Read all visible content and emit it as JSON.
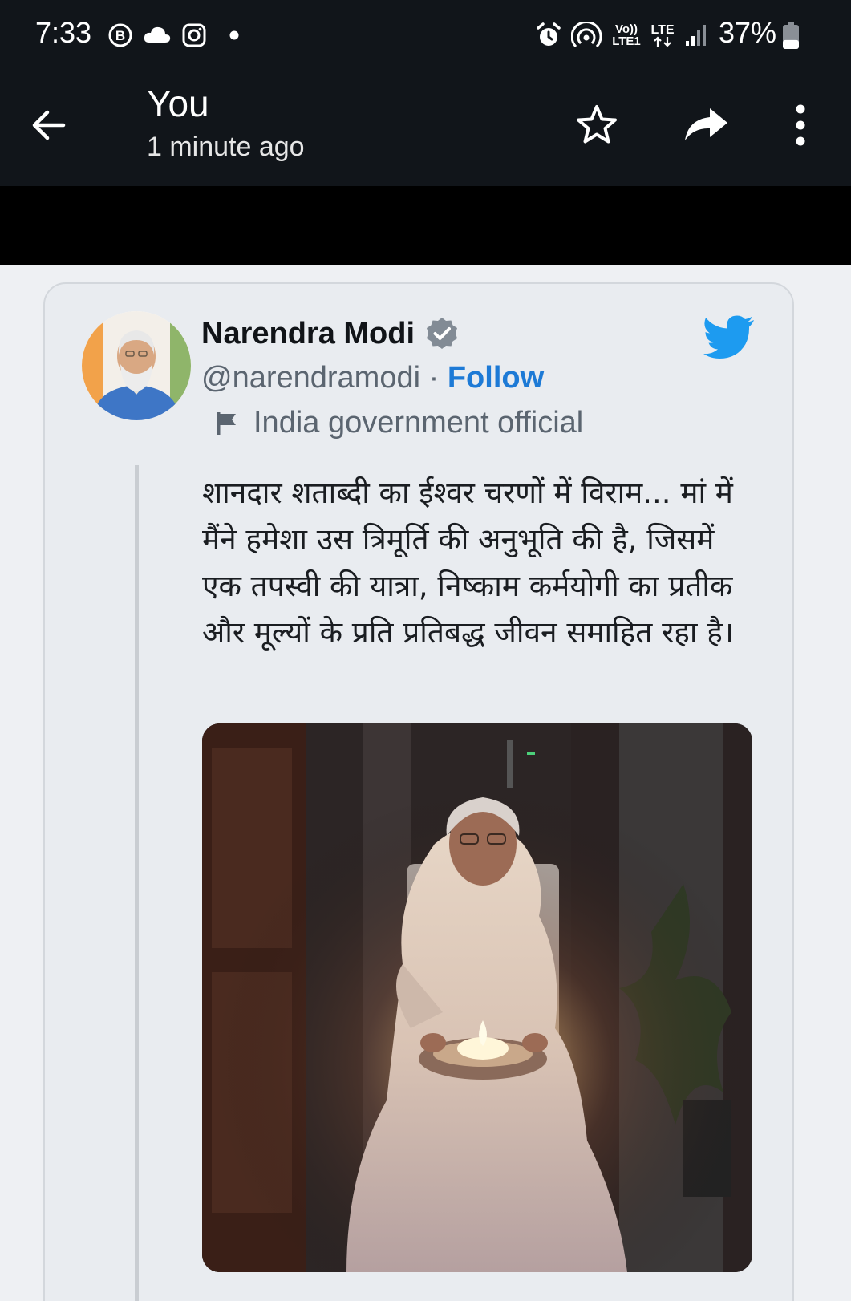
{
  "status_bar": {
    "time": "7:33",
    "left_icons": [
      "b-badge-icon",
      "cloud-icon",
      "instagram-icon",
      "dot-icon"
    ],
    "right_icons": [
      "alarm-icon",
      "hotspot-icon",
      "volte-icon",
      "lte-icon",
      "signal-icon"
    ],
    "volte_label": "Vo))",
    "volte_sub": "LTE1",
    "lte_label": "LTE",
    "battery_percent": "37%",
    "battery_level": 0.37
  },
  "header": {
    "title": "You",
    "subtitle": "1 minute ago",
    "actions": [
      "star-icon",
      "share-icon",
      "more-vert-icon"
    ]
  },
  "tweet": {
    "author_name": "Narendra Modi",
    "handle": "@narendramodi",
    "separator": " · ",
    "follow_label": "Follow",
    "account_label": "India government official",
    "text": "शानदार शताब्दी का ईश्वर चरणों में विराम... मां में मैंने हमेशा उस त्रिमूर्ति की अनुभूति की है, जिसमें एक तपस्वी की यात्रा, निष्काम कर्मयोगी का प्रतीक और मूल्यों के प्रति प्रतिबद्ध जीवन समाहित रहा है।",
    "colors": {
      "follow": "#1d7ad6",
      "twitter_blue": "#1d9bf0",
      "verified": "#828b95"
    }
  }
}
